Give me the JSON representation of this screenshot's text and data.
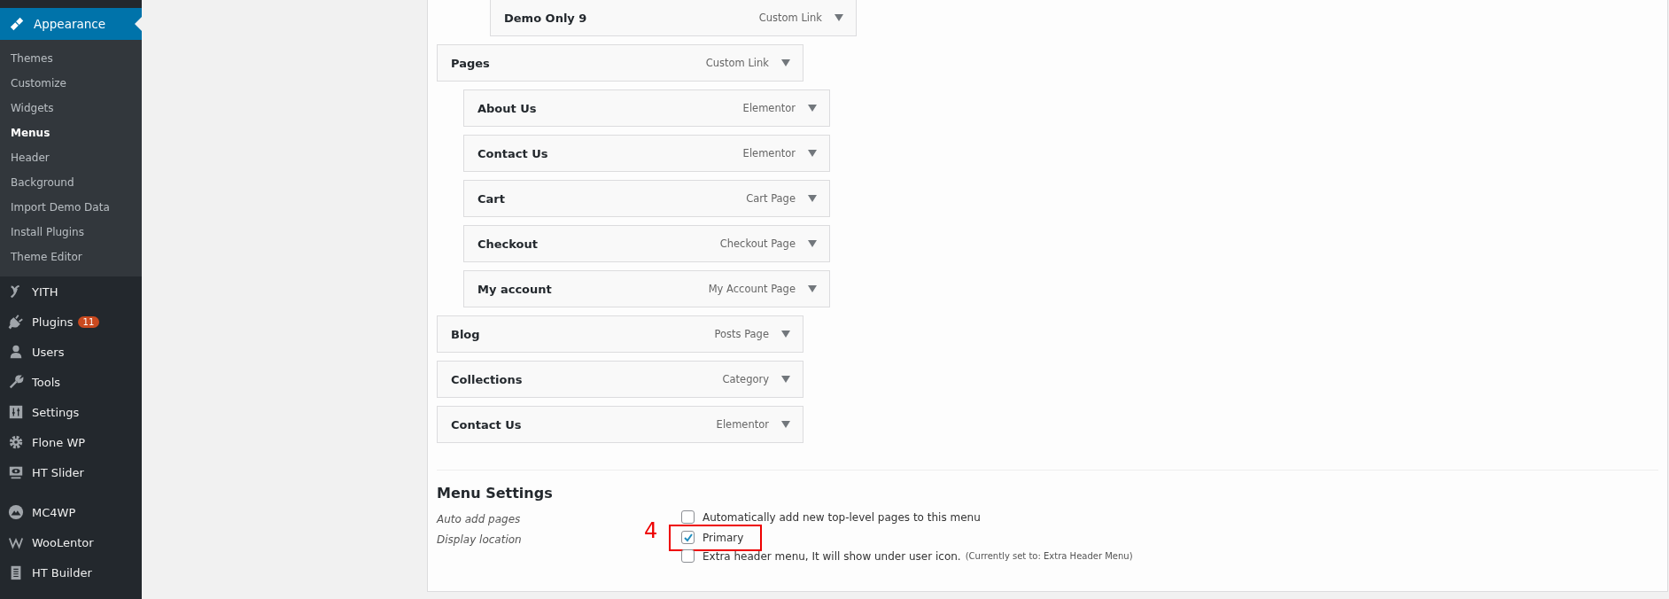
{
  "sidebar": {
    "current": {
      "label": "Appearance",
      "submenu": [
        {
          "label": "Themes",
          "selected": false
        },
        {
          "label": "Customize",
          "selected": false
        },
        {
          "label": "Widgets",
          "selected": false
        },
        {
          "label": "Menus",
          "selected": true
        },
        {
          "label": "Header",
          "selected": false
        },
        {
          "label": "Background",
          "selected": false
        },
        {
          "label": "Import Demo Data",
          "selected": false
        },
        {
          "label": "Install Plugins",
          "selected": false
        },
        {
          "label": "Theme Editor",
          "selected": false
        }
      ]
    },
    "groups": [
      [
        {
          "label": "YITH"
        },
        {
          "label": "Plugins",
          "badge": "11"
        },
        {
          "label": "Users"
        },
        {
          "label": "Tools"
        },
        {
          "label": "Settings"
        },
        {
          "label": "Flone WP"
        },
        {
          "label": "HT Slider"
        }
      ],
      [
        {
          "label": "MC4WP"
        },
        {
          "label": "WooLentor"
        },
        {
          "label": "HT Builder"
        }
      ]
    ]
  },
  "menu_structure": {
    "items": [
      {
        "children": [
          {
            "children": [
              {
                "title": "Demo Only 9",
                "type": "Custom Link"
              }
            ]
          }
        ]
      },
      {
        "title": "Pages",
        "type": "Custom Link",
        "children": [
          {
            "title": "About Us",
            "type": "Elementor"
          },
          {
            "title": "Contact Us",
            "type": "Elementor"
          },
          {
            "title": "Cart",
            "type": "Cart Page"
          },
          {
            "title": "Checkout",
            "type": "Checkout Page"
          },
          {
            "title": "My account",
            "type": "My Account Page"
          }
        ]
      },
      {
        "title": "Blog",
        "type": "Posts Page"
      },
      {
        "title": "Collections",
        "type": "Category"
      },
      {
        "title": "Contact Us",
        "type": "Elementor"
      }
    ]
  },
  "menu_settings": {
    "heading": "Menu Settings",
    "rows": [
      {
        "label": "Auto add pages",
        "options": [
          {
            "label": "Automatically add new top-level pages to this menu",
            "checked": false
          }
        ]
      },
      {
        "label": "Display location",
        "options": [
          {
            "label": "Primary",
            "checked": true,
            "callout": "4"
          },
          {
            "label": "Extra header menu, It will show under user icon.",
            "note": "(Currently set to: Extra Header Menu)",
            "checked": false
          }
        ]
      }
    ]
  }
}
